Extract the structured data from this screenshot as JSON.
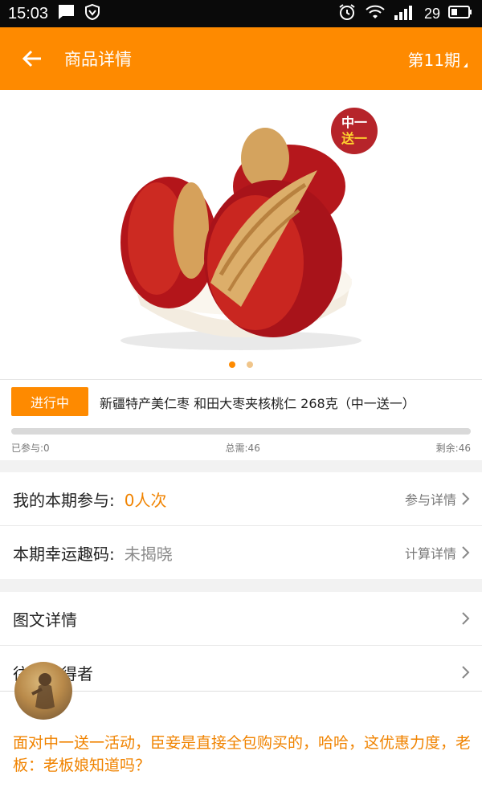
{
  "status_bar": {
    "time": "15:03",
    "battery": "29"
  },
  "app_bar": {
    "title": "商品详情",
    "period": "第11期"
  },
  "hero": {
    "badge_line1": "中一",
    "badge_line2": "送一",
    "carousel_count": 2,
    "carousel_active": 0
  },
  "product": {
    "status": "进行中",
    "name": "新疆特产美仁枣 和田大枣夹核桃仁 268克（中一送一）",
    "participated": "已参与:0",
    "total": "总需:46",
    "remaining": "剩余:46",
    "progress_fraction": 0
  },
  "rows": {
    "my_participation": {
      "label": "我的本期参与:",
      "value": "0人次",
      "link": "参与详情"
    },
    "lucky_code": {
      "label": "本期幸运趣码:",
      "value": "未揭晓",
      "link": "计算详情"
    },
    "details": {
      "label": "图文详情"
    },
    "past_winners": {
      "label": "往期获得者"
    }
  },
  "comment": {
    "text": "面对中一送一活动，臣妾是直接全包购买的，哈哈，这优惠力度，老板：老板娘知道吗？"
  },
  "colors": {
    "accent": "#fe8a00",
    "badge": "#b6242a",
    "value_orange": "#f08300",
    "value_gray": "#8a8a8a"
  }
}
